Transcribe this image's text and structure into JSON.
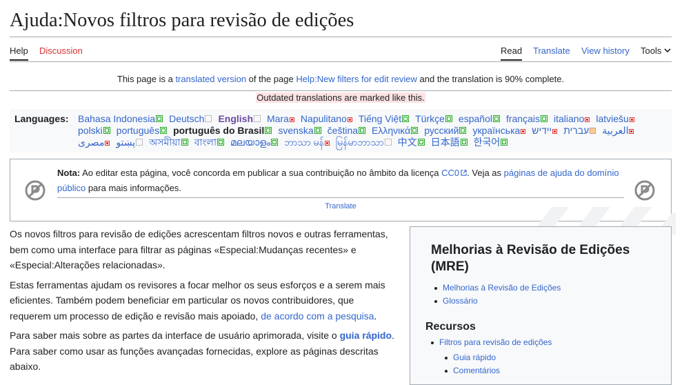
{
  "page": {
    "title": "Ajuda:Novos filtros para revisão de edições"
  },
  "tabs": {
    "help": "Help",
    "discussion": "Discussion",
    "read": "Read",
    "translate": "Translate",
    "view_history": "View history",
    "tools": "Tools"
  },
  "translation_notice": {
    "part1": "This page is a ",
    "link1": "translated version",
    "part2": " of the page ",
    "link2": "Help:New filters for edit review",
    "part3": " and the translation is 90% complete.",
    "outdated": "Outdated translations are marked like this."
  },
  "languages": {
    "label": "Languages:",
    "items": [
      {
        "name": "Bahasa Indonesia",
        "status": "complete",
        "style": "link"
      },
      {
        "name": "Deutsch",
        "status": "none",
        "style": "link"
      },
      {
        "name": "English",
        "status": "none",
        "style": "source"
      },
      {
        "name": "Mara",
        "status": "low",
        "style": "link"
      },
      {
        "name": "Napulitano",
        "status": "low",
        "style": "link"
      },
      {
        "name": "Tiếng Việt",
        "status": "complete",
        "style": "link"
      },
      {
        "name": "Türkçe",
        "status": "complete",
        "style": "link"
      },
      {
        "name": "español",
        "status": "complete",
        "style": "link"
      },
      {
        "name": "français",
        "status": "complete",
        "style": "link"
      },
      {
        "name": "italiano",
        "status": "low",
        "style": "link"
      },
      {
        "name": "latviešu",
        "status": "low",
        "style": "link"
      },
      {
        "name": "polski",
        "status": "complete",
        "style": "link"
      },
      {
        "name": "português",
        "status": "complete",
        "style": "link"
      },
      {
        "name": "português do Brasil",
        "status": "complete",
        "style": "current"
      },
      {
        "name": "svenska",
        "status": "complete",
        "style": "link"
      },
      {
        "name": "čeština",
        "status": "complete",
        "style": "link"
      },
      {
        "name": "Ελληνικά",
        "status": "complete",
        "style": "link"
      },
      {
        "name": "русский",
        "status": "complete",
        "style": "link"
      },
      {
        "name": "українська",
        "status": "low",
        "style": "link"
      },
      {
        "name": "יידיש",
        "status": "low",
        "style": "link"
      },
      {
        "name": "עברית",
        "status": "partial",
        "style": "link"
      },
      {
        "name": "العربية",
        "status": "low",
        "style": "link"
      },
      {
        "name": "مصرى",
        "status": "low",
        "style": "link"
      },
      {
        "name": "پښتو",
        "status": "none",
        "style": "link"
      },
      {
        "name": "অসমীয়া",
        "status": "complete",
        "style": "link"
      },
      {
        "name": "বাংলা",
        "status": "complete",
        "style": "link"
      },
      {
        "name": "മലയാളം",
        "status": "complete",
        "style": "link"
      },
      {
        "name": "ဘာသာ မန်",
        "status": "low",
        "style": "link"
      },
      {
        "name": "မြန်မာဘာသာ",
        "status": "none",
        "style": "link"
      },
      {
        "name": "中文",
        "status": "complete",
        "style": "link"
      },
      {
        "name": "日本語",
        "status": "complete",
        "style": "link"
      },
      {
        "name": "한국어",
        "status": "complete",
        "style": "link"
      }
    ]
  },
  "nota": {
    "bold": "Nota:",
    "text1": " Ao editar esta página, você concorda em publicar a sua contribuição no âmbito da licença ",
    "link_cc0": "CC0",
    "text2": ". Veja as ",
    "link_help": "páginas de ajuda do domínio público",
    "text3": " para mais informações.",
    "translate": "Translate"
  },
  "content": {
    "p1": "Os novos filtros para revisão de edições acrescentam filtros novos e outras ferramentas, bem como uma interface para filtrar as páginas «Especial:Mudanças recentes» e «Especial:Alterações relacionadas».",
    "p2_text": "Estas ferramentas ajudam os revisores a focar melhor os seus esforços e a serem mais eficientes. Também podem beneficiar em particular os novos contribuidores, que requerem um processo de edição e revisão mais apoiado, ",
    "p2_link": "de acordo com a pesquisa",
    "p2_end": ".",
    "p3_text": "Para saber mais sobre as partes da interface de usuário aprimorada, visite o ",
    "p3_link": "guia rápido",
    "p3_end": ". Para saber como usar as funções avançadas fornecidas, explore as páginas descritas abaixo."
  },
  "sidebar": {
    "title": "Melhorias à Revisão de Edições (MRE)",
    "links": [
      "Melhorias à Revisão de Edições",
      "Glossário"
    ],
    "heading": "Recursos",
    "resources": "Filtros para revisão de edições",
    "sub_links": [
      "Guia rápido",
      "Comentários"
    ]
  },
  "colors": {
    "link": "#3366cc",
    "red_link": "#d73333",
    "text": "#202122",
    "border": "#a2a9b1",
    "box_bg": "#f8f9fa",
    "outdated_bg": "#fce3e3"
  }
}
